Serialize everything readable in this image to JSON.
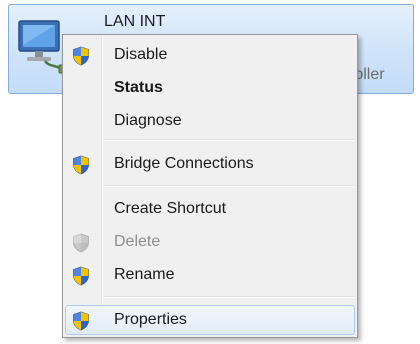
{
  "connection": {
    "title": "LAN INT",
    "subtitle_partial": "roller"
  },
  "menu": {
    "disable": "Disable",
    "status": "Status",
    "diagnose": "Diagnose",
    "bridge_connections": "Bridge Connections",
    "create_shortcut": "Create Shortcut",
    "delete": "Delete",
    "rename": "Rename",
    "properties": "Properties"
  },
  "icons": {
    "uac_shield": "shield-icon",
    "network_adapter": "network-adapter-icon"
  },
  "colors": {
    "tile_border": "#84acdd",
    "tile_fill": "#cfe3fa",
    "menu_background": "#f0f0f0",
    "hover_border": "#aeccf1",
    "shield_blue": "#2f64c8",
    "shield_yellow": "#f5c400"
  }
}
